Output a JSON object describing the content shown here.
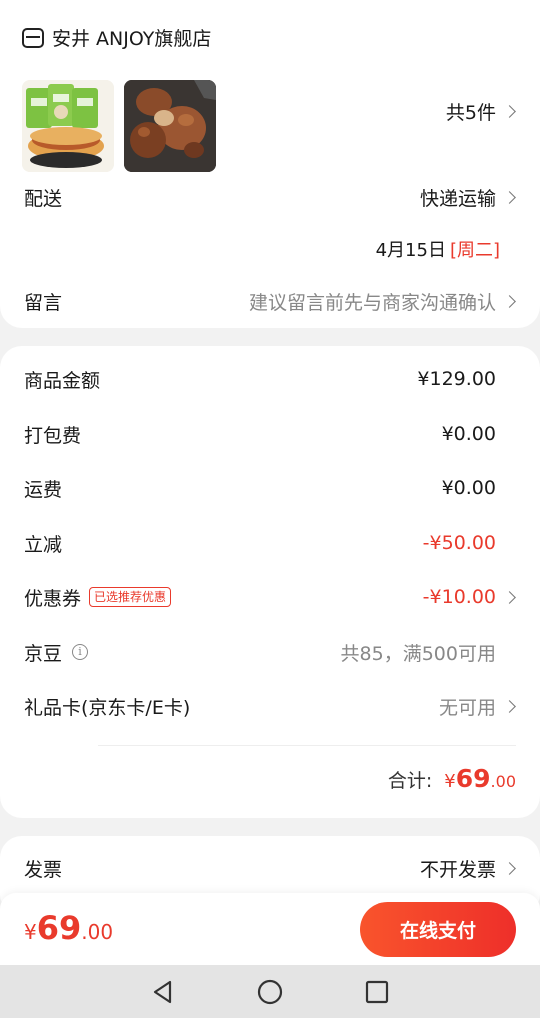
{
  "shop": {
    "name": "安井 ANJOY旗舰店",
    "icon": "store-icon"
  },
  "products": {
    "count_label": "共5件",
    "thumbs": [
      "product-thumbnail-pastry",
      "product-thumbnail-meat"
    ]
  },
  "delivery": {
    "label": "配送",
    "method": "快递运输",
    "date": "4月15日",
    "weekday": "[周二]"
  },
  "message": {
    "label": "留言",
    "placeholder": "建议留言前先与商家沟通确认"
  },
  "summary": {
    "goods_amount": {
      "label": "商品金额",
      "value": "¥129.00"
    },
    "packing_fee": {
      "label": "打包费",
      "value": "¥0.00"
    },
    "shipping_fee": {
      "label": "运费",
      "value": "¥0.00"
    },
    "instant_discount": {
      "label": "立减",
      "value": "-¥50.00"
    },
    "coupon": {
      "label": "优惠券",
      "tag": "已选推荐优惠",
      "value": "-¥10.00"
    },
    "jingdou": {
      "label": "京豆",
      "value": "共85，满500可用"
    },
    "gift_card": {
      "label": "礼品卡(京东卡/E卡)",
      "value": "无可用"
    },
    "total": {
      "label": "合计:",
      "symbol": "¥",
      "integer": "69",
      "decimal": ".00"
    }
  },
  "invoice": {
    "label": "发票",
    "value": "不开发票"
  },
  "bottom": {
    "symbol": "¥",
    "integer": "69",
    "decimal": ".00",
    "pay_label": "在线支付"
  },
  "nav": {
    "back": "back-icon",
    "home": "home-icon",
    "recents": "recents-icon"
  },
  "colors": {
    "accent": "#e93a2c",
    "button_start": "#f9542c",
    "button_end": "#ee2f2a"
  }
}
